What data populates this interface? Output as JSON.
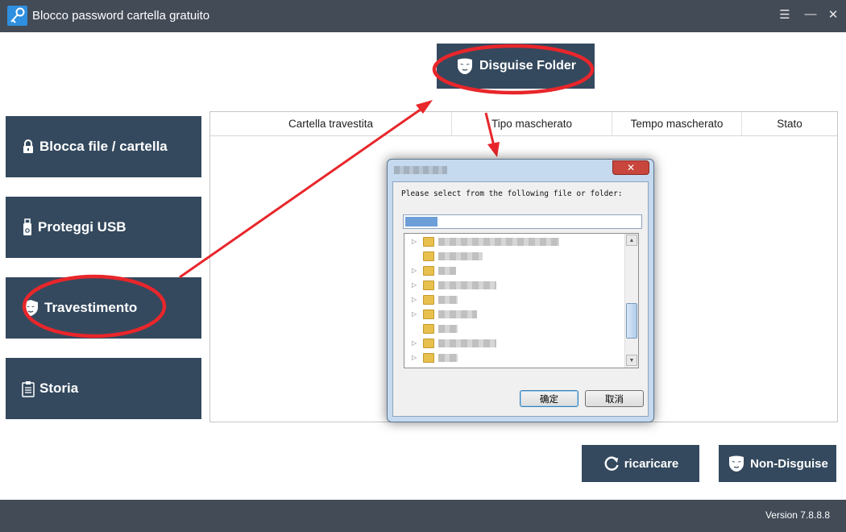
{
  "window": {
    "title": "Blocco password cartella gratuito",
    "controls": {
      "menu": "☰",
      "minimize": "—",
      "close": "✕"
    }
  },
  "sidebar": {
    "items": [
      {
        "label": "Blocca file / cartella",
        "icon": "lock-icon"
      },
      {
        "label": "Proteggi USB",
        "icon": "usb-icon"
      },
      {
        "label": "Travestimento",
        "icon": "mask-shield-icon"
      },
      {
        "label": "Storia",
        "icon": "clipboard-icon"
      }
    ]
  },
  "toolbar": {
    "disguise_folder_label": "Disguise Folder"
  },
  "table": {
    "columns": [
      "Cartella travestita",
      "Tipo mascherato",
      "Tempo mascherato",
      "Stato"
    ],
    "rows": []
  },
  "actions": {
    "reload_label": "ricaricare",
    "non_disguise_label": "Non-Disguise"
  },
  "footer": {
    "version": "Version 7.8.8.8"
  },
  "dialog": {
    "prompt": "Please select from the following file or folder:",
    "close_glyph": "✕",
    "ok_label": "确定",
    "cancel_label": "取消"
  },
  "colors": {
    "titlebar": "#434b57",
    "button": "#34495e",
    "annotation": "#e8262b"
  }
}
